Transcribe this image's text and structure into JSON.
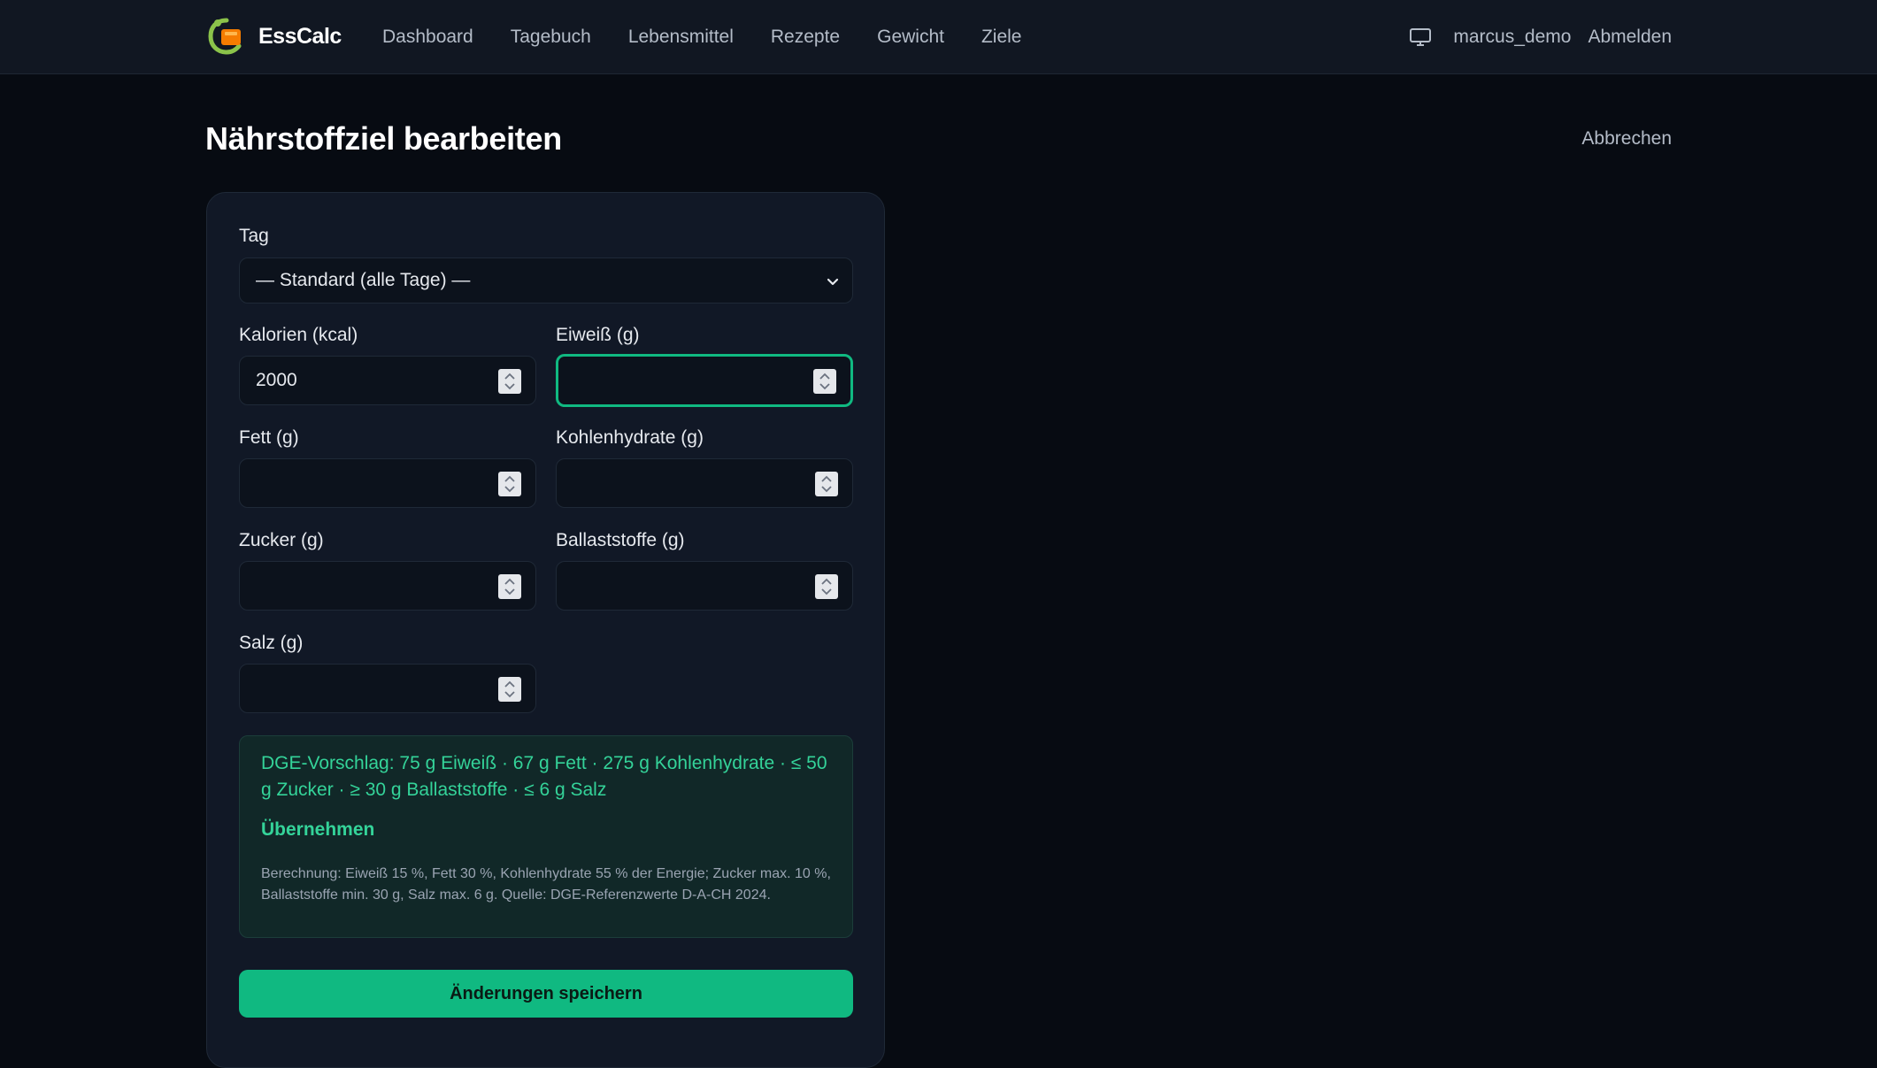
{
  "app": {
    "name": "EssCalc"
  },
  "nav": {
    "items": [
      "Dashboard",
      "Tagebuch",
      "Lebensmittel",
      "Rezepte",
      "Gewicht",
      "Ziele"
    ],
    "user": "marcus_demo",
    "logout": "Abmelden"
  },
  "page": {
    "title": "Nährstoffziel bearbeiten",
    "cancel": "Abbrechen"
  },
  "form": {
    "day_label": "Tag",
    "day_value": "— Standard (alle Tage) —",
    "fields": [
      {
        "label": "Kalorien (kcal)",
        "value": "2000"
      },
      {
        "label": "Eiweiß (g)",
        "value": ""
      },
      {
        "label": "Fett (g)",
        "value": ""
      },
      {
        "label": "Kohlenhydrate (g)",
        "value": ""
      },
      {
        "label": "Zucker (g)",
        "value": ""
      },
      {
        "label": "Ballaststoffe (g)",
        "value": ""
      },
      {
        "label": "Salz (g)",
        "value": ""
      }
    ],
    "focused_field": "Eiweiß (g)"
  },
  "suggestion": {
    "text": "DGE-Vorschlag: 75 g Eiweiß · 67 g Fett · 275 g Kohlenhydrate · ≤ 50 g Zucker · ≥ 30 g Ballaststoffe · ≤ 6 g Salz",
    "apply": "Übernehmen",
    "note": "Berechnung: Eiweiß 15 %, Fett 30 %, Kohlenhydrate 55 % der Energie; Zucker max. 10 %, Ballaststoffe min. 30 g, Salz max. 6 g. Quelle: DGE-Referenzwerte D-A-CH 2024."
  },
  "save_button": "Änderungen speichern",
  "colors": {
    "accent": "#10b981",
    "background": "#070b12",
    "card": "#111826",
    "topbar": "#111722"
  },
  "icons": {
    "logo": "esscalc-logo-icon",
    "monitor": "monitor-icon",
    "select": "chevron-down-icon",
    "spinner": "number-spinner-icon"
  }
}
